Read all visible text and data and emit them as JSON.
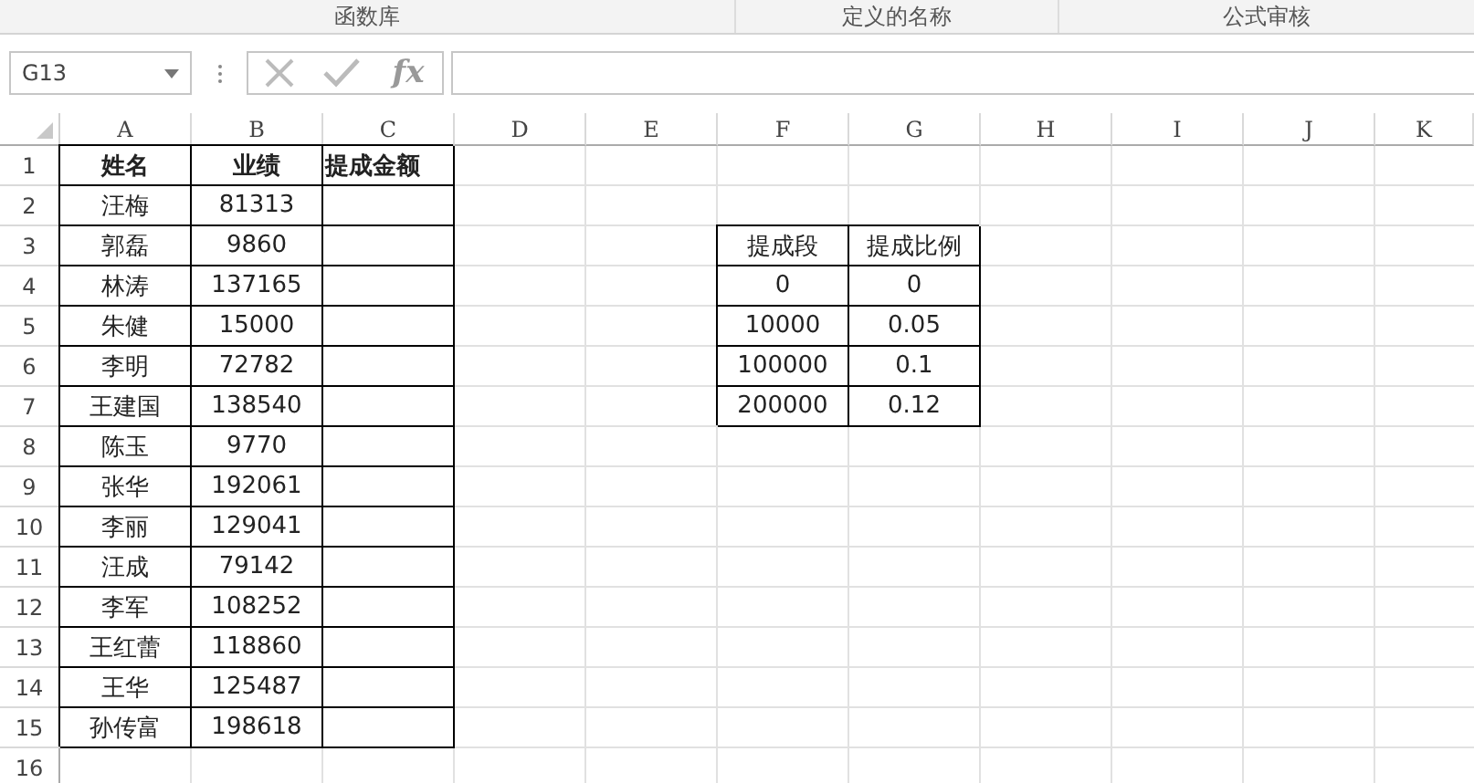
{
  "ribbon_groups": [
    "函数库",
    "定义的名称",
    "公式审核"
  ],
  "name_box": {
    "value": "G13"
  },
  "formula_bar": {
    "fx": "fx"
  },
  "columns": [
    "A",
    "B",
    "C",
    "D",
    "E",
    "F",
    "G",
    "H",
    "I",
    "J",
    "K"
  ],
  "rows": [
    {
      "number": "1",
      "cells": [
        {
          "text": "姓名",
          "bold": true,
          "bordered": true
        },
        {
          "text": "业绩",
          "bold": true,
          "bordered": true
        },
        {
          "text": "提成金额",
          "bold": true,
          "bordered": true,
          "left_aligned": true
        }
      ]
    },
    {
      "number": "2",
      "cells": [
        {
          "text": "汪梅",
          "bordered": true
        },
        {
          "text": "81313",
          "bordered": true
        },
        {
          "bordered": true
        }
      ]
    },
    {
      "number": "3",
      "cells": [
        {
          "text": "郭磊",
          "bordered": true
        },
        {
          "text": "9860",
          "bordered": true
        },
        {
          "bordered": true
        },
        {
          "bordered": false
        },
        {
          "bordered": false
        },
        {
          "text": "提成段",
          "bordered": true
        },
        {
          "text": "提成比例",
          "bordered": true
        }
      ]
    },
    {
      "number": "4",
      "cells": [
        {
          "text": "林涛",
          "bordered": true
        },
        {
          "text": "137165",
          "bordered": true
        },
        {
          "bordered": true
        },
        {
          "bordered": false
        },
        {
          "bordered": false
        },
        {
          "text": "0",
          "bordered": true
        },
        {
          "text": "0",
          "bordered": true
        }
      ]
    },
    {
      "number": "5",
      "cells": [
        {
          "text": "朱健",
          "bordered": true
        },
        {
          "text": "15000",
          "bordered": true
        },
        {
          "bordered": true
        },
        {
          "bordered": false
        },
        {
          "bordered": false
        },
        {
          "text": "10000",
          "bordered": true
        },
        {
          "text": "0.05",
          "bordered": true
        }
      ]
    },
    {
      "number": "6",
      "cells": [
        {
          "text": "李明",
          "bordered": true
        },
        {
          "text": "72782",
          "bordered": true
        },
        {
          "bordered": true
        },
        {
          "bordered": false
        },
        {
          "bordered": false
        },
        {
          "text": "100000",
          "bordered": true
        },
        {
          "text": "0.1",
          "bordered": true
        }
      ]
    },
    {
      "number": "7",
      "cells": [
        {
          "text": "王建国",
          "bordered": true
        },
        {
          "text": "138540",
          "bordered": true
        },
        {
          "bordered": true
        },
        {
          "bordered": false
        },
        {
          "bordered": false
        },
        {
          "text": "200000",
          "bordered": true
        },
        {
          "text": "0.12",
          "bordered": true
        }
      ]
    },
    {
      "number": "8",
      "cells": [
        {
          "text": "陈玉",
          "bordered": true
        },
        {
          "text": "9770",
          "bordered": true
        },
        {
          "bordered": true
        }
      ]
    },
    {
      "number": "9",
      "cells": [
        {
          "text": "张华",
          "bordered": true
        },
        {
          "text": "192061",
          "bordered": true
        },
        {
          "bordered": true
        }
      ]
    },
    {
      "number": "10",
      "cells": [
        {
          "text": "李丽",
          "bordered": true
        },
        {
          "text": "129041",
          "bordered": true
        },
        {
          "bordered": true
        }
      ]
    },
    {
      "number": "11",
      "cells": [
        {
          "text": "汪成",
          "bordered": true
        },
        {
          "text": "79142",
          "bordered": true
        },
        {
          "bordered": true
        }
      ]
    },
    {
      "number": "12",
      "cells": [
        {
          "text": "李军",
          "bordered": true
        },
        {
          "text": "108252",
          "bordered": true
        },
        {
          "bordered": true
        }
      ]
    },
    {
      "number": "13",
      "cells": [
        {
          "text": "王红蕾",
          "bordered": true
        },
        {
          "text": "118860",
          "bordered": true
        },
        {
          "bordered": true
        }
      ]
    },
    {
      "number": "14",
      "cells": [
        {
          "text": "王华",
          "bordered": true
        },
        {
          "text": "125487",
          "bordered": true
        },
        {
          "bordered": true
        }
      ]
    },
    {
      "number": "15",
      "cells": [
        {
          "text": "孙传富",
          "bordered": true
        },
        {
          "text": "198618",
          "bordered": true
        },
        {
          "bordered": true
        }
      ]
    },
    {
      "number": "16",
      "cells": []
    }
  ]
}
